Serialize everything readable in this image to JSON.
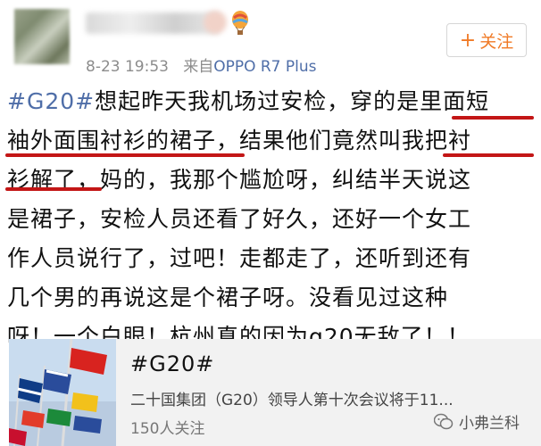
{
  "post": {
    "timestamp": "8-23 19:53",
    "source_prefix": "来自",
    "source_device": "OPPO R7 Plus",
    "follow_label": "关注",
    "text_lines": [
      {
        "topic": "#G20#",
        "text": "想起昨天我机场过安检，穿的是里面短"
      },
      {
        "topic": "",
        "text": "袖外面围衬衫的裙子，结果他们竟然叫我把衬"
      },
      {
        "topic": "",
        "text": "衫解了，妈的，我那个尴尬呀，纠结半天说这"
      },
      {
        "topic": "",
        "text": "是裙子，安检人员还看了好久，还好一个女工"
      },
      {
        "topic": "",
        "text": "作人员说行了，过吧！走都走了，还听到还有"
      },
      {
        "topic": "",
        "text": "几个男的再说这是个裙子呀。没看见过这种"
      },
      {
        "topic": "",
        "text": "呀！一个白眼！杭州真的因为g20无敌了！！"
      }
    ]
  },
  "topic_card": {
    "title": "#G20#",
    "description": "二十国集团（G20）领导人第十次会议将于11...",
    "follows": "150人关注"
  },
  "watermark": {
    "text": "小弗兰科"
  },
  "colors": {
    "link": "#4f6ea8",
    "follow": "#f07a26",
    "annotation": "#c31616"
  }
}
